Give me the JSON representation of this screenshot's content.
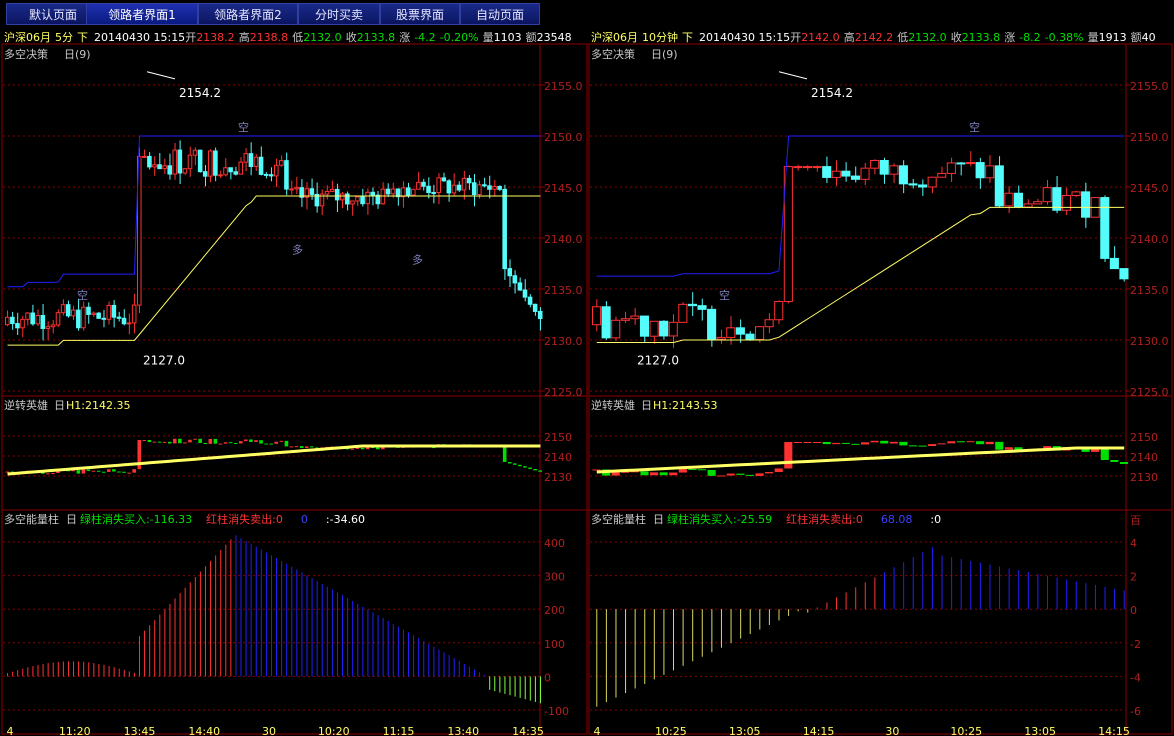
{
  "tabs": [
    {
      "label": "默认页面",
      "active": false
    },
    {
      "label": "领路者界面1",
      "active": true
    },
    {
      "label": "领路者界面2",
      "active": false
    },
    {
      "label": "分时买卖",
      "active": false
    },
    {
      "label": "股票界面",
      "active": false
    },
    {
      "label": "自动页面",
      "active": false
    }
  ],
  "colors": {
    "up": "#ff3232",
    "down": "#54fcfc",
    "grid": "#8c0000",
    "yellow": "#ffff64",
    "blue": "#2020ff",
    "green": "#00e000"
  },
  "left": {
    "info": {
      "symbol": "沪深06月",
      "period": "5分",
      "dir": "下",
      "dt": "20140430 15:15",
      "open_l": "开",
      "open": "2138.2",
      "high_l": "高",
      "high": "2138.8",
      "low_l": "低",
      "low": "2132.0",
      "close_l": "收",
      "close": "2133.8",
      "chg_l": "涨",
      "chg": "-4.2",
      "pct": "-0.20%",
      "vol_l": "量",
      "vol": "1103",
      "amt_l": "额",
      "amt": "23548"
    },
    "main": {
      "title": "多空决策",
      "param": "(9)",
      "yticks": [
        "2155.0",
        "2150.0",
        "2145.0",
        "2140.0",
        "2135.0",
        "2130.0",
        "2125.0"
      ],
      "hi_label": "2154.2",
      "lo_label": "2127.0",
      "kong": "空",
      "duo": "多"
    },
    "mid": {
      "title": "逆转英雄",
      "h1": "H1:2142.35",
      "yticks": [
        "2150",
        "2140",
        "2130"
      ]
    },
    "bot": {
      "title": "多空能量柱",
      "green_txt": "绿柱消失买入:-116.33",
      "red_txt": "红柱消失卖出:0",
      "blue_txt": "0",
      "white_txt": ":-34.60",
      "yticks": [
        "400",
        "300",
        "200",
        "100",
        "0",
        "-100"
      ]
    },
    "xlabels": [
      "4",
      "11:20",
      "13:45",
      "14:40",
      "30",
      "10:20",
      "11:15",
      "13:40",
      "14:35"
    ]
  },
  "right": {
    "info": {
      "symbol": "沪深06月",
      "period": "10分钟",
      "dir": "下",
      "dt": "20140430 15:15",
      "open_l": "开",
      "open": "2142.0",
      "high_l": "高",
      "high": "2142.2",
      "low_l": "低",
      "low": "2132.0",
      "close_l": "收",
      "close": "2133.8",
      "chg_l": "涨",
      "chg": "-8.2",
      "pct": "-0.38%",
      "vol_l": "量",
      "vol": "1913",
      "amt_l": "额",
      "amt": "40"
    },
    "main": {
      "title": "多空决策",
      "param": "(9)",
      "yticks": [
        "2155.0",
        "2150.0",
        "2145.0",
        "2140.0",
        "2135.0",
        "2130.0",
        "2125.0"
      ],
      "hi_label": "2154.2",
      "lo_label": "2127.0",
      "kong": "空"
    },
    "mid": {
      "title": "逆转英雄",
      "h1": "H1:2143.53",
      "yticks": [
        "2150",
        "2140",
        "2130"
      ]
    },
    "bot": {
      "title": "多空能量柱",
      "green_txt": "绿柱消失买入:-25.59",
      "red_txt": "红柱消失卖出:0",
      "blue_txt": "68.08",
      "white_txt": ":0",
      "unit": "百",
      "yticks": [
        "4",
        "2",
        "0",
        "-2",
        "-4",
        "-6"
      ]
    },
    "xlabels": [
      "4",
      "10:25",
      "13:05",
      "14:15",
      "30",
      "10:25",
      "13:05",
      "14:15"
    ]
  }
}
